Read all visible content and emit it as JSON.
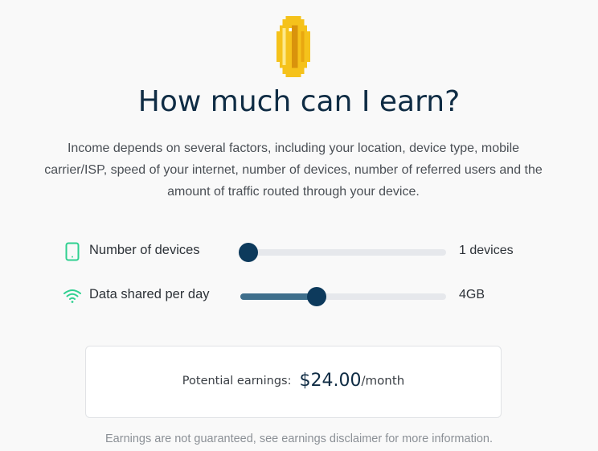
{
  "logo": {
    "icon": "gold-coin-icon"
  },
  "heading": "How much can I earn?",
  "intro": "Income depends on several factors, including your location, device type, mobile carrier/ISP, speed of your internet, number of devices, number of referred users and the amount of traffic routed through your device.",
  "sliders": {
    "devices": {
      "icon": "phone-icon",
      "label": "Number of devices",
      "value_text": "1 devices",
      "level": 0.04
    },
    "data": {
      "icon": "wifi-icon",
      "label": "Data shared per day",
      "value_text": "4GB",
      "level": 0.37
    }
  },
  "earnings": {
    "label": "Potential earnings:",
    "amount": "$24.00",
    "unit": "/month"
  },
  "disclaimer": "Earnings are not guaranteed, see earnings disclaimer for more information.",
  "colors": {
    "accent_dark": "#0d3a5c",
    "slider_fill": "#3f6f8c",
    "icon_green": "#2fd090",
    "coin_gold": "#f5c21b"
  }
}
